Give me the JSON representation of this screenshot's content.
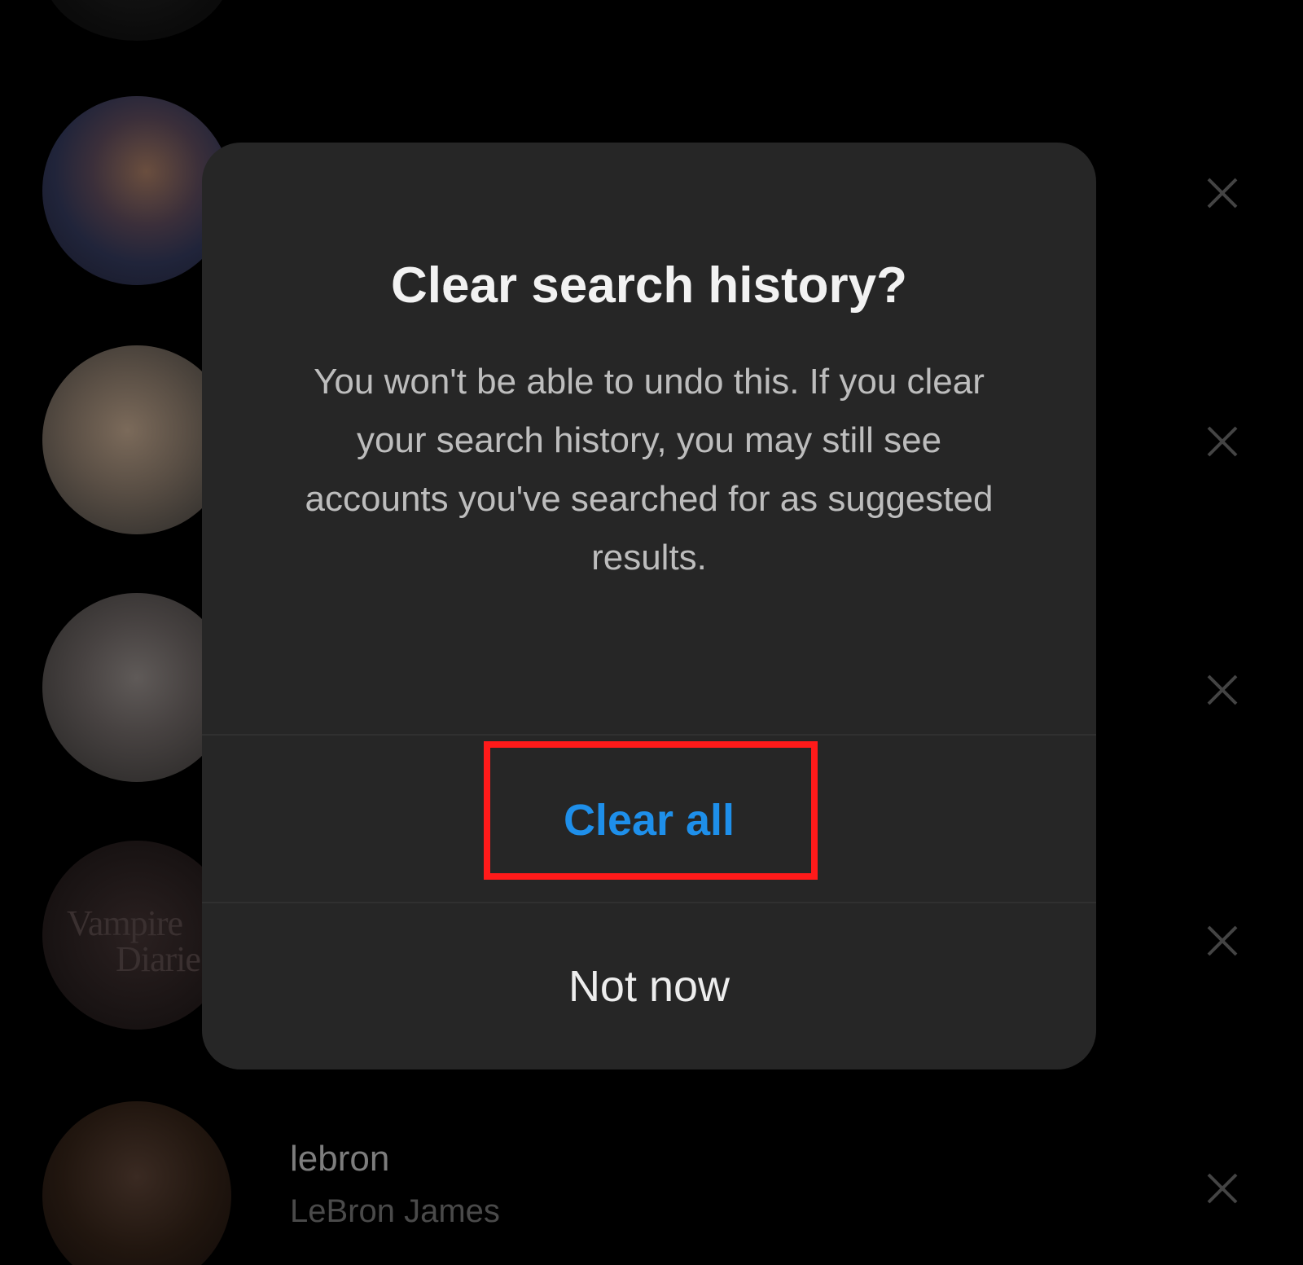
{
  "dialog": {
    "title": "Clear search history?",
    "message": "You won't be able to undo this. If you clear your search history, you may still see accounts you've searched for as suggested results.",
    "primary_button": "Clear all",
    "secondary_button": "Not now"
  },
  "history": {
    "items": [
      {
        "username": "",
        "fullname": "",
        "avatar": "avatar-photo"
      },
      {
        "username": "",
        "fullname": "",
        "avatar": "avatar-photo"
      },
      {
        "username": "",
        "fullname": "",
        "avatar": "avatar-photo"
      },
      {
        "username": "",
        "fullname": "",
        "avatar": "avatar-photo"
      },
      {
        "username": "",
        "fullname": "",
        "avatar": "avatar-photo",
        "avatar_text_1": "Vampire",
        "avatar_text_2": "Diarie"
      },
      {
        "username": "lebron",
        "fullname": "LeBron James",
        "avatar": "avatar-photo"
      }
    ],
    "remove_icon": "close-icon"
  },
  "colors": {
    "background": "#000000",
    "dialog_background": "#262626",
    "primary_action": "#1e8fea",
    "highlight": "#ff1a1a"
  }
}
